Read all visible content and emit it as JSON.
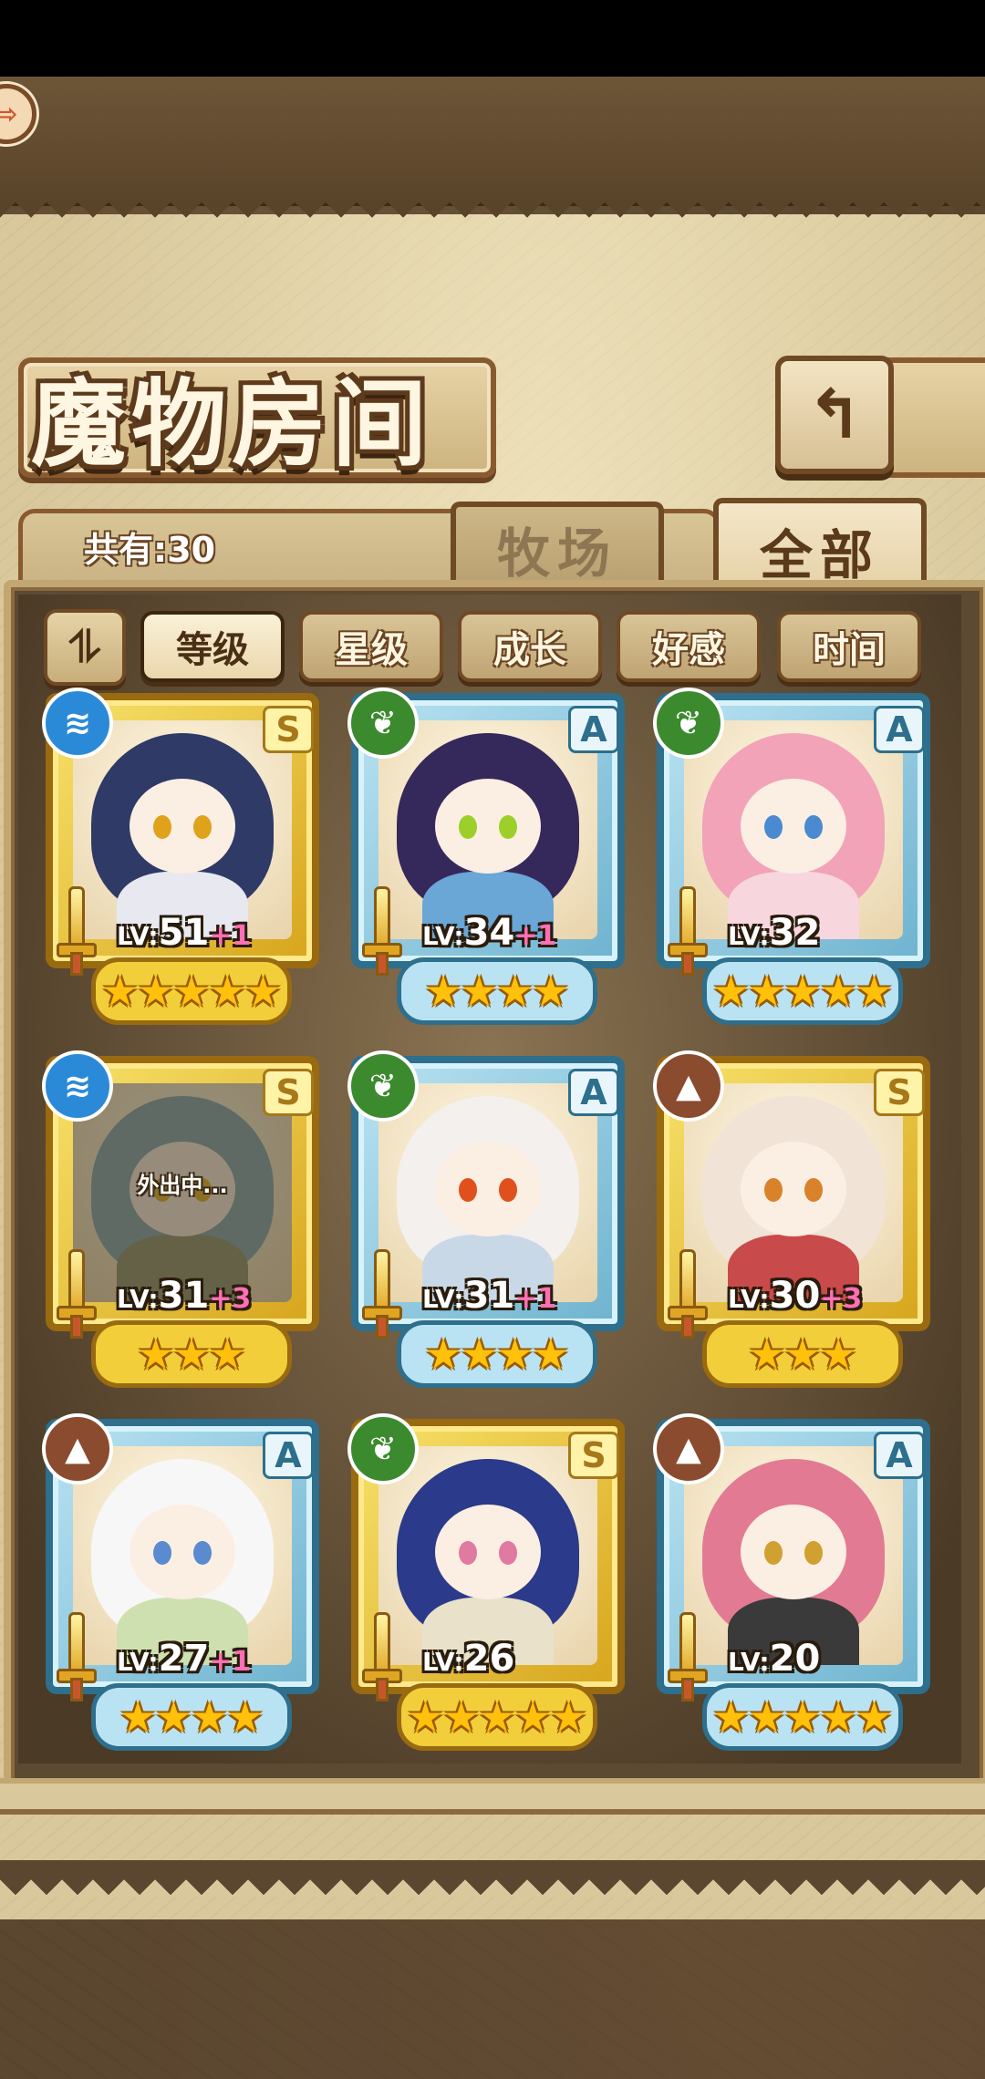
{
  "header": {
    "title": "魔物房间",
    "back_symbol": "⇨",
    "return_symbol": "↰"
  },
  "summary": {
    "count_text": "共有:30"
  },
  "tabs": [
    {
      "label": "牧场",
      "active": false
    },
    {
      "label": "全部",
      "active": true
    }
  ],
  "sort": {
    "toggle_symbol": "⥮",
    "buttons": [
      {
        "label": "等级",
        "selected": true
      },
      {
        "label": "星级",
        "selected": false
      },
      {
        "label": "成长",
        "selected": false
      },
      {
        "label": "好感",
        "selected": false
      },
      {
        "label": "时间",
        "selected": false
      }
    ]
  },
  "monsters": [
    {
      "rank": "S",
      "element": "water",
      "level_prefix": "LV:",
      "level": "51",
      "plus": "+1",
      "stars": 5,
      "frame": "gold",
      "status": "",
      "hair": "#2f3a66",
      "eyes": "#e0a21a",
      "body": "#e8e8f0"
    },
    {
      "rank": "A",
      "element": "leaf",
      "level_prefix": "LV:",
      "level": "34",
      "plus": "+1",
      "stars": 4,
      "frame": "blue",
      "status": "",
      "hair": "#35285a",
      "eyes": "#9ccf2a",
      "body": "#6aa6d6"
    },
    {
      "rank": "A",
      "element": "leaf",
      "level_prefix": "LV:",
      "level": "32",
      "plus": "",
      "stars": 5,
      "frame": "blue",
      "status": "",
      "hair": "#f2a3b8",
      "eyes": "#4a8ad0",
      "body": "#f7d6de"
    },
    {
      "rank": "S",
      "element": "water",
      "level_prefix": "LV:",
      "level": "31",
      "plus": "+3",
      "stars": 3,
      "frame": "gold",
      "status": "外出中...",
      "hair": "#7fa3ae",
      "eyes": "#e0b020",
      "body": "#8a8f6a"
    },
    {
      "rank": "A",
      "element": "leaf",
      "level_prefix": "LV:",
      "level": "31",
      "plus": "+1",
      "stars": 4,
      "frame": "blue",
      "status": "",
      "hair": "#f4f0ee",
      "eyes": "#e0501c",
      "body": "#c9d8e6"
    },
    {
      "rank": "S",
      "element": "earth",
      "level_prefix": "LV:",
      "level": "30",
      "plus": "+3",
      "stars": 3,
      "frame": "gold",
      "status": "",
      "hair": "#f1e3d6",
      "eyes": "#d9822a",
      "body": "#c94a4a"
    },
    {
      "rank": "A",
      "element": "earth",
      "level_prefix": "LV:",
      "level": "27",
      "plus": "+1",
      "stars": 4,
      "frame": "blue",
      "status": "",
      "hair": "#f7f7f7",
      "eyes": "#5a8ad0",
      "body": "#cfe0b0"
    },
    {
      "rank": "S",
      "element": "leaf",
      "level_prefix": "LV:",
      "level": "26",
      "plus": "",
      "stars": 5,
      "frame": "gold",
      "status": "",
      "hair": "#2b3a8a",
      "eyes": "#e07aa0",
      "body": "#e9e1c9"
    },
    {
      "rank": "A",
      "element": "earth",
      "level_prefix": "LV:",
      "level": "20",
      "plus": "",
      "stars": 5,
      "frame": "blue",
      "status": "",
      "hair": "#e37a94",
      "eyes": "#d0a030",
      "body": "#3a3a3a"
    }
  ],
  "element_icons": {
    "water": "≋",
    "leaf": "❦",
    "earth": "▲"
  },
  "colors": {
    "gold_frame": "#f7e26a",
    "blue_frame": "#b9e3f2",
    "plus_text": "#ff6fb5",
    "parchment": "#d9c89c"
  }
}
